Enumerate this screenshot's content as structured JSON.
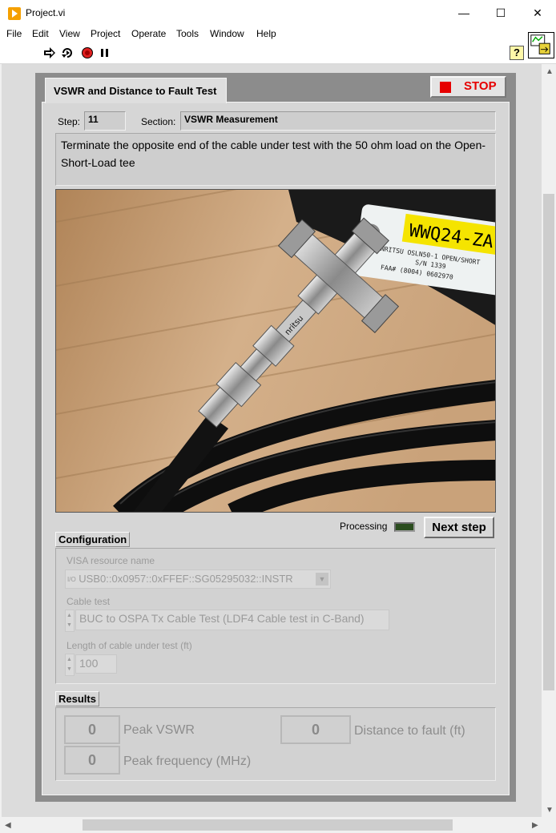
{
  "window": {
    "title": "Project.vi",
    "minimize": "—",
    "maximize": "☐",
    "close": "✕"
  },
  "menu": [
    "File",
    "Edit",
    "View",
    "Project",
    "Operate",
    "Tools",
    "Window",
    "Help"
  ],
  "toolbar": {
    "help": "?"
  },
  "tab": {
    "label": "VSWR and Distance to Fault Test"
  },
  "stop": {
    "label": "STOP"
  },
  "step": {
    "label": "Step:",
    "value": "11"
  },
  "section": {
    "label": "Section:",
    "value": "VSWR Measurement"
  },
  "instruction": "Terminate the opposite end of the cable under test with the 50 ohm load on the Open-Short-Load tee",
  "photo": {
    "tag_text": "WWQ24-ZA",
    "tag_line1": "ANRITSU OSLN50-1 OPEN/SHORT",
    "tag_line2": "S/N 1339",
    "tag_line3": "FAA# (8004) 0602970",
    "connector_text": "nritsu"
  },
  "processing": {
    "label": "Processing"
  },
  "next_step": {
    "label": "Next step"
  },
  "configuration": {
    "label": "Configuration",
    "visa_label": "VISA resource name",
    "visa_icon": "I/O",
    "visa_value": "USB0::0x0957::0xFFEF::SG05295032::INSTR",
    "cable_test_label": "Cable test",
    "cable_test_value": "BUC to OSPA Tx Cable Test (LDF4 Cable test in C-Band)",
    "length_label": "Length of cable under test (ft)",
    "length_value": "100"
  },
  "results": {
    "label": "Results",
    "peak_vswr_value": "0",
    "peak_vswr_label": "Peak VSWR",
    "distance_value": "0",
    "distance_label": "Distance to fault (ft)",
    "peak_freq_value": "0",
    "peak_freq_label": "Peak frequency (MHz)"
  },
  "colors": {
    "stop_red": "#e60000",
    "led_off": "#2b4d1e",
    "app_icon": "#f5a000"
  }
}
